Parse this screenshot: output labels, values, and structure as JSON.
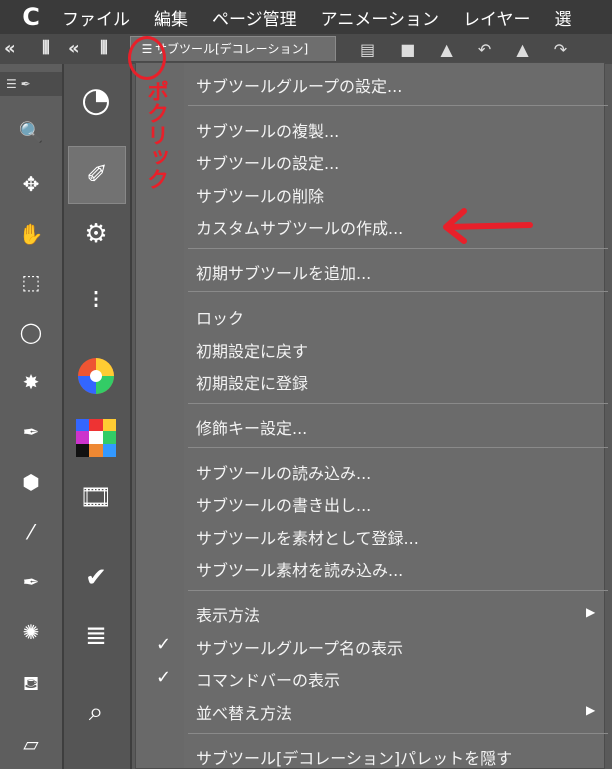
{
  "menubar": {
    "logo": "C",
    "items": [
      "ファイル",
      "編集",
      "ページ管理",
      "アニメーション",
      "レイヤー",
      "選"
    ]
  },
  "palette_tab": {
    "icon": "menu-icon",
    "label": "サブツール[デコレーション]"
  },
  "context_menu": {
    "items": [
      {
        "label": "サブツールグループの設定..."
      },
      {
        "label": "サブツールの複製..."
      },
      {
        "label": "サブツールの設定..."
      },
      {
        "label": "サブツールの削除"
      },
      {
        "label": "カスタムサブツールの作成..."
      },
      {
        "label": "初期サブツールを追加..."
      },
      {
        "label": "ロック"
      },
      {
        "label": "初期設定に戻す"
      },
      {
        "label": "初期設定に登録"
      },
      {
        "label": "修飾キー設定..."
      },
      {
        "label": "サブツールの読み込み..."
      },
      {
        "label": "サブツールの書き出し..."
      },
      {
        "label": "サブツールを素材として登録..."
      },
      {
        "label": "サブツール素材を読み込み..."
      },
      {
        "label": "表示方法",
        "submenu": true
      },
      {
        "label": "サブツールグループ名の表示",
        "checked": true
      },
      {
        "label": "コマンドバーの表示",
        "checked": true
      },
      {
        "label": "並べ替え方法",
        "submenu": true
      },
      {
        "label": "サブツール[デコレーション]パレットを隠す"
      }
    ]
  },
  "annotation": {
    "text": "ポクリック",
    "color": "#e8202a"
  },
  "colors": {
    "menubar": "#3a3a3a",
    "menu_bg": "#6b6b6b",
    "annotation": "#e8202a"
  }
}
